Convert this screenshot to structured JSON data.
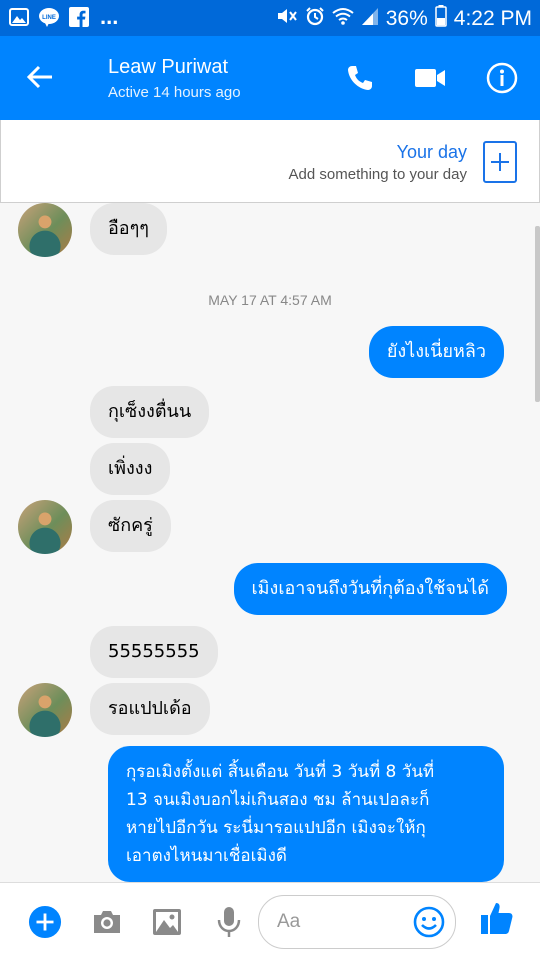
{
  "status_bar": {
    "notification_icons": [
      "image-icon",
      "line-app-icon",
      "facebook-icon"
    ],
    "more": "...",
    "battery": "36%",
    "time": "4:22 PM"
  },
  "header": {
    "contact_name": "Leaw Puriwat",
    "active_status": "Active 14 hours ago"
  },
  "your_day": {
    "title": "Your day",
    "subtitle": "Add something to your day"
  },
  "messages": {
    "m1": "อือๆๆ",
    "date_separator": "MAY 17 AT 4:57 AM",
    "m2": "ยังไงเนี่ยหลิว",
    "m3": "กุเซ็งงตื่นน",
    "m4": "เพิ่งงง",
    "m5": "ซักครู่",
    "m6": "เมิงเอาจนถึงวันที่กุต้องใช้จนได้",
    "m7": "55555555",
    "m8": "รอแปปเด้อ",
    "m9_lines": [
      "กุรอเมิงตั้งแต่ สิ้นเดือน วันที่ 3 วันที่ 8 วันที่",
      "13 จนเมิงบอกไม่เกินสอง ชม ล้านเปอละก็",
      "หายไปอีกวัน ระนี่มารอแปปอีก เมิงจะให้กุ",
      "เอาตงไหนมาเชื่อเมิงดี"
    ]
  },
  "composer": {
    "placeholder": "Aa"
  },
  "colors": {
    "status_bar": "#0069d9",
    "header": "#0084ff",
    "outgoing_bubble": "#0084ff",
    "incoming_bubble": "#e6e6e6"
  }
}
